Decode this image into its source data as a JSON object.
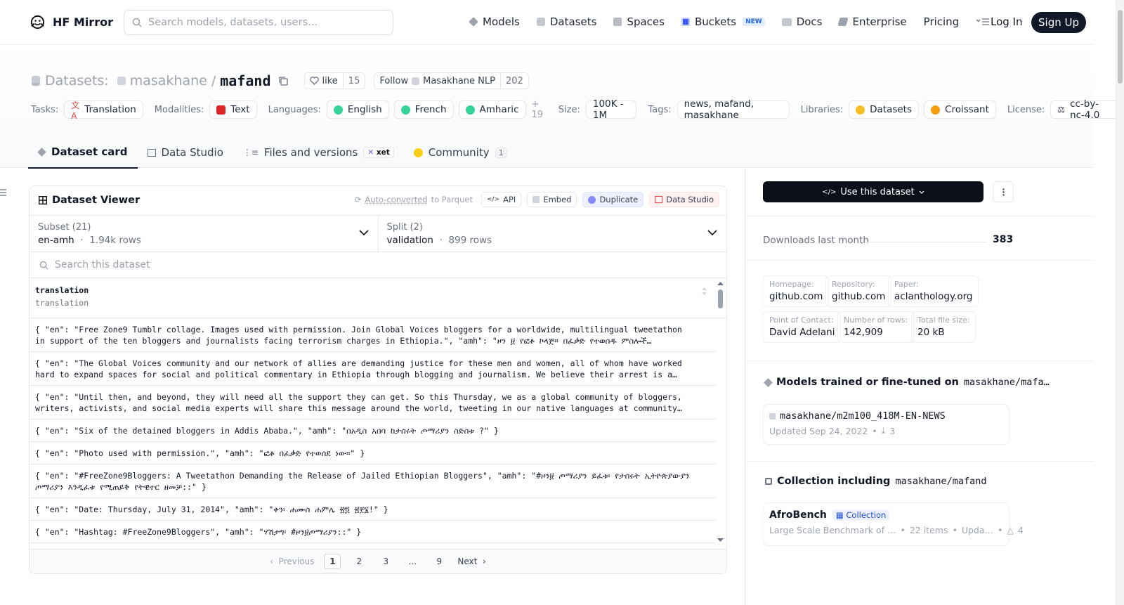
{
  "header": {
    "brand": "HF Mirror",
    "search_placeholder": "Search models, datasets, users...",
    "nav": [
      {
        "label": "Models",
        "icon": "cube-icon"
      },
      {
        "label": "Datasets",
        "icon": "database-icon"
      },
      {
        "label": "Spaces",
        "icon": "grid-icon"
      },
      {
        "label": "Buckets",
        "icon": "bucket-icon",
        "badge": "NEW"
      },
      {
        "label": "Docs",
        "icon": "book-icon"
      },
      {
        "label": "Enterprise",
        "icon": "enterprise-icon"
      },
      {
        "label": "Pricing"
      }
    ],
    "login": "Log In",
    "signup": "Sign Up"
  },
  "repo": {
    "prefix": "Datasets:",
    "owner": "masakhane",
    "separator": "/",
    "name": "mafand",
    "like_label": "like",
    "like_count": "15",
    "follow_label": "Follow",
    "follow_org": "Masakhane NLP",
    "follow_count": "202"
  },
  "meta": {
    "tasks_label": "Tasks:",
    "task": "Translation",
    "modalities_label": "Modalities:",
    "modality": "Text",
    "languages_label": "Languages:",
    "languages": [
      "English",
      "French",
      "Amharic"
    ],
    "languages_more": "+ 19",
    "size_label": "Size:",
    "size": "100K - 1M",
    "tags_label": "Tags:",
    "tags": "news, mafand, masakhane",
    "libraries_label": "Libraries:",
    "libraries": [
      "Datasets",
      "Croissant"
    ],
    "license_label": "License:",
    "license": "cc-by-nc-4.0"
  },
  "tabs": {
    "card": "Dataset card",
    "studio": "Data Studio",
    "files": "Files and versions",
    "xet": "xet",
    "community": "Community",
    "community_count": "1"
  },
  "viewer": {
    "title": "Dataset Viewer",
    "autoconv_a": "Auto-converted",
    "autoconv_b": "to Parquet",
    "api": "API",
    "embed": "Embed",
    "duplicate": "Duplicate",
    "studio": "Data Studio",
    "subset_label": "Subset (21)",
    "subset_value": "en-amh",
    "subset_rows": "1.94k rows",
    "split_label": "Split (2)",
    "split_value": "validation",
    "split_rows": "899 rows",
    "search_placeholder": "Search this dataset",
    "column_name": "translation",
    "column_type": "translation",
    "rows": [
      {
        "l1": "{ \"en\": \"Free Zone9 Tumblr collage. Images used with permission. Join Global Voices bloggers for a worldwide, multilingual tweetathon",
        "l2": "in support of the ten bloggers and journalists facing terrorism charges in Ethiopia.\", \"amh\": \"ዞን ፱ የፎቶ ኮላጅ። በፈቃድ የተወሰዱ ምስሎች…"
      },
      {
        "l1": "{ \"en\": \"The Global Voices community and our network of allies are demanding justice for these men and women, all of whom have worked",
        "l2": "hard to expand spaces for social and political commentary in Ethiopia through blogging and journalism. We believe their arrest is a…"
      },
      {
        "l1": "{ \"en\": \"Until then, and beyond, they will need all the support they can get. So this Thursday, we as a global community of bloggers,",
        "l2": "writers, activists, and social media experts will share this message around the world, tweeting in our native languages at community…"
      },
      {
        "l1": "{ \"en\": \"Six of the detained bloggers in Addis Ababa.\", \"amh\": \"በአዲስ አበባ ከታሰሩት ጦማሪያን ስድስቱ ?\" }",
        "l2": ""
      },
      {
        "l1": "{ \"en\": \"Photo used with permission.\", \"amh\": \"ፎቶ በፈቃድ የተወሰደ ነው።\" }",
        "l2": ""
      },
      {
        "l1": "{ \"en\": \"#FreeZone9Bloggers: A Tweetathon Demanding the Release of Jailed Ethiopian Bloggers\", \"amh\": \"#ዞን፱ ጦማሪያን ይፈቱ፡ የታሰሩት ኢትዮጵያውያን",
        "l2": "ጦማሪያን እንዲፈቱ የሚጠይቅ የትዊተር ዘመቻ::\" }"
      },
      {
        "l1": "{ \"en\": \"Date: Thursday, July 31, 2014\", \"amh\": \"ቀን፡ ሐሙስ ሐምሌ ፳፬ ፳፻፮!\" }",
        "l2": ""
      },
      {
        "l1": "{ \"en\": \"Hashtag: #FreeZone9Bloggers\", \"amh\": \"ሃሽታግ፡ #ዞን፱ጦማሪያን::\" }",
        "l2": ""
      }
    ],
    "pager": {
      "prev": "Previous",
      "pages": [
        "1",
        "2",
        "3",
        "...",
        "9"
      ],
      "next": "Next",
      "current": "1"
    }
  },
  "sidebar": {
    "use_button": "Use this dataset",
    "downloads_label": "Downloads last month",
    "downloads_value": "383",
    "cards": [
      {
        "label": "Homepage:",
        "value": "github.com"
      },
      {
        "label": "Repository:",
        "value": "github.com"
      },
      {
        "label": "Paper:",
        "value": "aclanthology.org"
      },
      {
        "label": "Point of Contact:",
        "value": "David Adelani"
      },
      {
        "label": "Number of rows:",
        "value": "142,909"
      },
      {
        "label": "Total file size:",
        "value": "20 kB"
      }
    ],
    "models_title": "Models trained or fine-tuned on",
    "models_repo": "masakhane/mafa…",
    "model_name": "masakhane/m2m100_418M-EN-NEWS",
    "model_updated": "Updated Sep 24, 2022",
    "model_downloads": "3",
    "collection_title": "Collection including",
    "collection_repo": "masakhane/mafand",
    "collection_name": "AfroBench",
    "collection_badge": "Collection",
    "collection_desc": "Large Scale Benchmark of …",
    "collection_items": "22 items",
    "collection_updated": "Upda…",
    "collection_upvotes": "4"
  }
}
